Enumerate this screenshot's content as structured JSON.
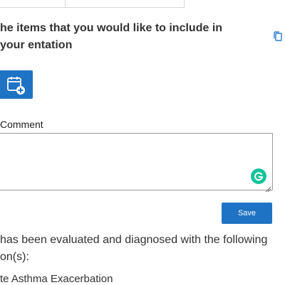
{
  "heading": {
    "text": "he items that you would like to include in your entation"
  },
  "icons": {
    "copy": "copy-icon",
    "calendar": "calendar-add-icon",
    "grammarly": "grammarly-icon"
  },
  "comment": {
    "label": "Comment",
    "value": ""
  },
  "save": {
    "label": "Save"
  },
  "diagnosis": {
    "intro": "has been evaluated and diagnosed with the following on(s):",
    "items": [
      "te Asthma Exacerbation"
    ]
  },
  "colors": {
    "accent": "#1f73c4",
    "grammarly": "#15c39a"
  }
}
